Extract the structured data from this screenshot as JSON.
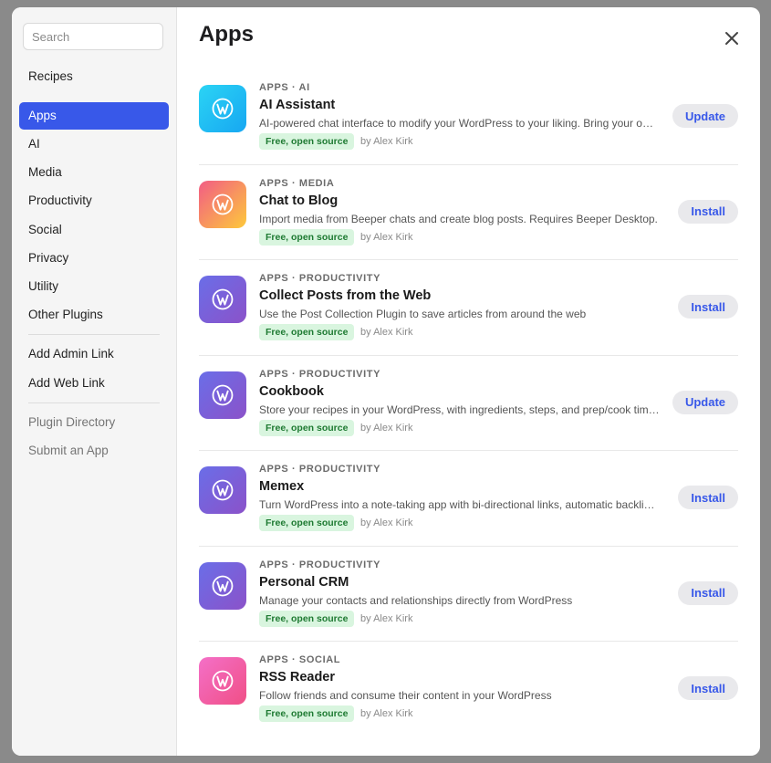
{
  "sidebar": {
    "search_placeholder": "Search",
    "items": [
      {
        "label": "Recipes"
      },
      {
        "label": "Apps"
      },
      {
        "label": "AI"
      },
      {
        "label": "Media"
      },
      {
        "label": "Productivity"
      },
      {
        "label": "Social"
      },
      {
        "label": "Privacy"
      },
      {
        "label": "Utility"
      },
      {
        "label": "Other Plugins"
      },
      {
        "label": "Add Admin Link"
      },
      {
        "label": "Add Web Link"
      },
      {
        "label": "Plugin Directory"
      },
      {
        "label": "Submit an App"
      }
    ],
    "active_item": "Apps"
  },
  "main": {
    "title": "Apps",
    "apps": [
      {
        "category": "APPS · AI",
        "name": "AI Assistant",
        "description": "AI-powered chat interface to modify your WordPress to your liking. Bring your own API key.",
        "badge": "Free, open source",
        "author": "by Alex Kirk",
        "action": "Update",
        "gradient": [
          "#2bd4f4",
          "#17a7f2"
        ]
      },
      {
        "category": "APPS · MEDIA",
        "name": "Chat to Blog",
        "description": "Import media from Beeper chats and create blog posts. Requires Beeper Desktop.",
        "badge": "Free, open source",
        "author": "by Alex Kirk",
        "action": "Install",
        "gradient": [
          "#f25c85",
          "#fdc93b"
        ]
      },
      {
        "category": "APPS · PRODUCTIVITY",
        "name": "Collect Posts from the Web",
        "description": "Use the Post Collection Plugin to save articles from around the web",
        "badge": "Free, open source",
        "author": "by Alex Kirk",
        "action": "Install",
        "gradient": [
          "#6a6ee8",
          "#8b52c9"
        ]
      },
      {
        "category": "APPS · PRODUCTIVITY",
        "name": "Cookbook",
        "description": "Store your recipes in your WordPress, with ingredients, steps, and prep/cook times.",
        "badge": "Free, open source",
        "author": "by Alex Kirk",
        "action": "Update",
        "gradient": [
          "#6a6ee8",
          "#8b52c9"
        ]
      },
      {
        "category": "APPS · PRODUCTIVITY",
        "name": "Memex",
        "description": "Turn WordPress into a note-taking app with bi-directional links, automatic backlinks.",
        "badge": "Free, open source",
        "author": "by Alex Kirk",
        "action": "Install",
        "gradient": [
          "#6a6ee8",
          "#8b52c9"
        ]
      },
      {
        "category": "APPS · PRODUCTIVITY",
        "name": "Personal CRM",
        "description": "Manage your contacts and relationships directly from WordPress",
        "badge": "Free, open source",
        "author": "by Alex Kirk",
        "action": "Install",
        "gradient": [
          "#6a6ee8",
          "#8b52c9"
        ]
      },
      {
        "category": "APPS · SOCIAL",
        "name": "RSS Reader",
        "description": "Follow friends and consume their content in your WordPress",
        "badge": "Free, open source",
        "author": "by Alex Kirk",
        "action": "Install",
        "gradient": [
          "#f470c8",
          "#f04f86"
        ]
      }
    ]
  },
  "colors": {
    "accent": "#3858e9",
    "badge_bg": "#d9f5df",
    "badge_text": "#1e7a32"
  }
}
